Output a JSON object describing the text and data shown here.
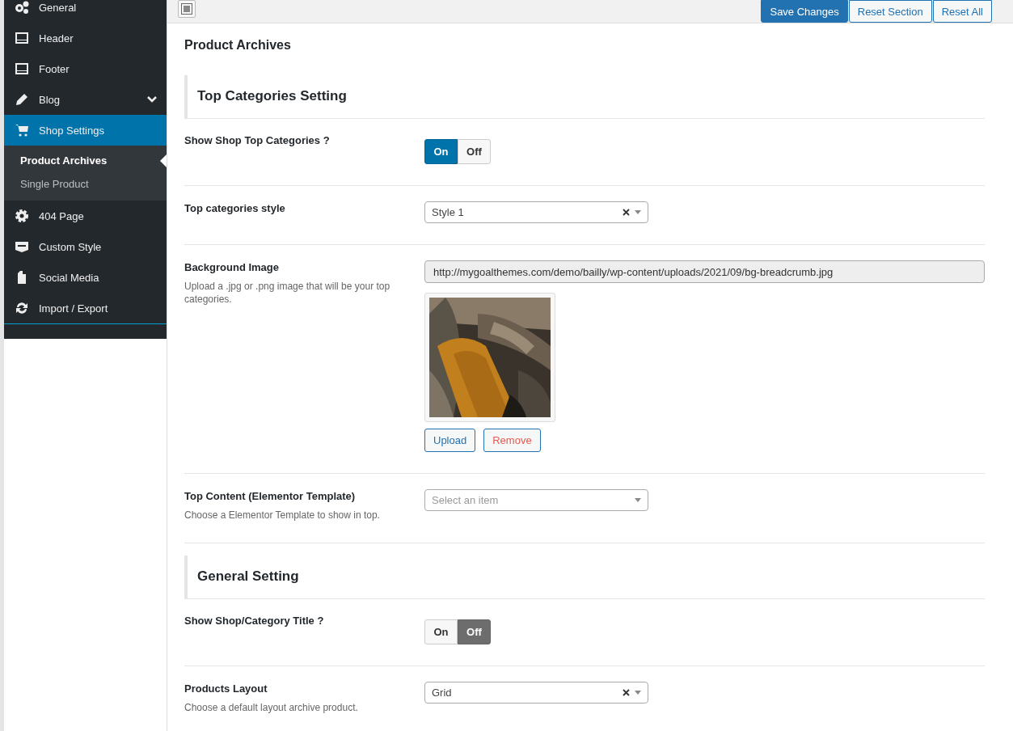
{
  "sidebar": {
    "items": [
      {
        "label": "General",
        "kind": "gears",
        "selected": false
      },
      {
        "label": "Header",
        "kind": "layout",
        "selected": false
      },
      {
        "label": "Footer",
        "kind": "layout",
        "selected": false
      },
      {
        "label": "Blog",
        "kind": "pencil",
        "selected": false,
        "expanded": false
      },
      {
        "label": "Shop Settings",
        "kind": "cart",
        "selected": true,
        "children": [
          {
            "label": "Product Archives",
            "selected": true
          },
          {
            "label": "Single Product",
            "selected": false
          }
        ]
      },
      {
        "label": "404 Page",
        "kind": "gear",
        "selected": false
      },
      {
        "label": "Custom Style",
        "kind": "css",
        "selected": false
      },
      {
        "label": "Social Media",
        "kind": "file",
        "selected": false
      },
      {
        "label": "Import / Export",
        "kind": "refresh",
        "selected": false
      }
    ]
  },
  "toolbar": {
    "buttons": [
      {
        "label": "Save Changes",
        "kind": "primary"
      },
      {
        "label": "Reset Section",
        "kind": "secondary"
      },
      {
        "label": "Reset All",
        "kind": "secondary"
      }
    ]
  },
  "page_title": "Product Archives",
  "rows": [
    {
      "kind": "section",
      "title": "Top Categories Setting"
    },
    {
      "kind": "toggle",
      "label": "Show Shop Top Categories ?",
      "options": [
        {
          "label": "On",
          "selected": true
        },
        {
          "label": "Off",
          "selected": false
        }
      ]
    },
    {
      "kind": "select",
      "label": "Top categories style",
      "value": "Style 1"
    },
    {
      "kind": "media",
      "label": "Background Image",
      "description": "Upload a .jpg or .png image that will be your top categories.",
      "value": "http://mygoalthemes.com/demo/bailly/wp-content/uploads/2021/09/bg-breadcrumb.jpg",
      "upload": "Upload",
      "remove": "Remove"
    },
    {
      "kind": "select",
      "label": "Top Content (Elementor Template)",
      "description": "Choose a Elementor Template to show in top.",
      "placeholder": "Select an item"
    },
    {
      "kind": "section",
      "title": "General Setting"
    },
    {
      "kind": "toggle",
      "label": "Show Shop/Category Title ?",
      "options": [
        {
          "label": "On",
          "selected": false
        },
        {
          "label": "Off",
          "selected": true
        }
      ]
    },
    {
      "kind": "select",
      "label": "Products Layout",
      "description": "Choose a default layout archive product.",
      "value": "Grid"
    }
  ]
}
